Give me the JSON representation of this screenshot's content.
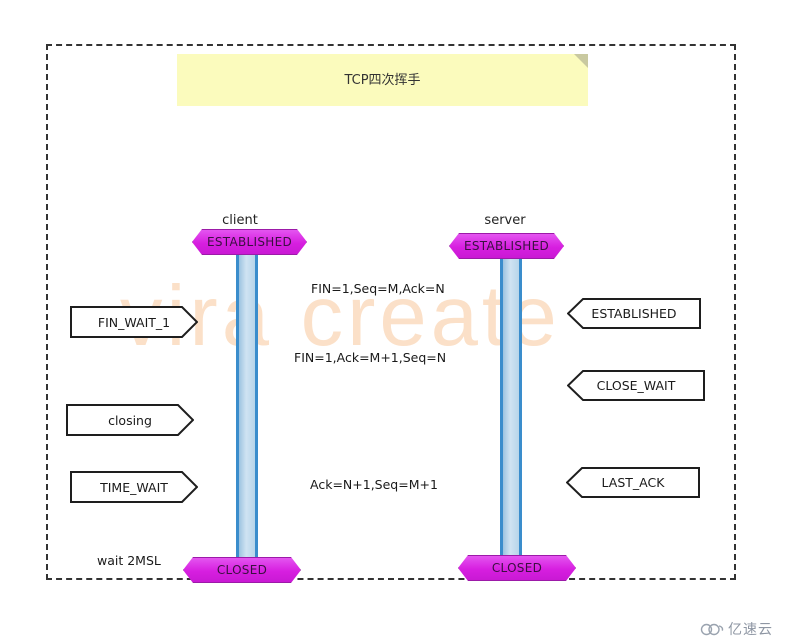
{
  "diagram": {
    "kind": "uml-sequence-diagram",
    "title": "TCP四次挥手",
    "watermark": "vira create",
    "colors": {
      "frame_border": "#333333",
      "title_background": "#fbfbbd",
      "state_hexagon_fill": "#d71fe0",
      "state_hexagon_border": "#9c1aa8",
      "activation_fill": "#b7d5ea",
      "activation_border": "#3a8dcc",
      "client_icon": "#2e7ba6",
      "server_icon": "#1d2c3d",
      "watermark": "#fbe0c8",
      "note_border": "#1e1e1e",
      "arrow": "#111111"
    },
    "lifelines": [
      {
        "id": "client",
        "label": "client",
        "icon": "person-at-computer-icon"
      },
      {
        "id": "server",
        "label": "server",
        "icon": "server-tower-icon"
      }
    ],
    "states": {
      "client_established": "ESTABLISHED",
      "server_established": "ESTABLISHED",
      "client_closed": "CLOSED",
      "server_closed": "CLOSED"
    },
    "client_notes": [
      {
        "id": "fin-wait-1",
        "label": "FIN_WAIT_1"
      },
      {
        "id": "closing",
        "label": "closing"
      },
      {
        "id": "time-wait",
        "label": "TIME_WAIT"
      }
    ],
    "server_notes": [
      {
        "id": "established",
        "label": "ESTABLISHED"
      },
      {
        "id": "close-wait",
        "label": "CLOSE_WAIT"
      },
      {
        "id": "last-ack",
        "label": "LAST_ACK"
      }
    ],
    "messages": [
      {
        "id": "msg-1",
        "label": "FIN=1,Seq=M,Ack=N",
        "from": "client",
        "to": "server",
        "direction": "right"
      },
      {
        "id": "msg-2",
        "label": "FIN=1,Ack=M+1,Seq=N",
        "from": "server",
        "to": "client",
        "direction": "left"
      },
      {
        "id": "msg-3",
        "label": "Ack=N+1,Seq=M+1",
        "from": "client",
        "to": "server",
        "direction": "right"
      }
    ],
    "annotations": [
      {
        "id": "wait-2msl",
        "label": "wait 2MSL"
      }
    ]
  },
  "footer": {
    "logo_text": "亿速云",
    "logo_icon": "cloud-icon"
  }
}
